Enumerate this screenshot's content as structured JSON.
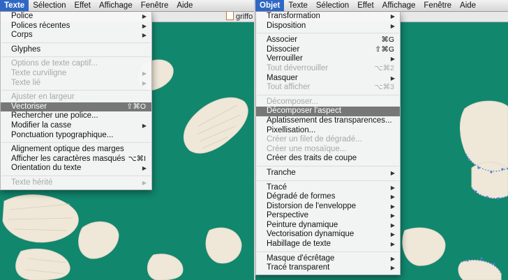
{
  "colors": {
    "canvas": "#11876e",
    "scribble": "#efe7d7",
    "highlight": "#777777",
    "menubar_active": "#2f68c4"
  },
  "left": {
    "menubar": [
      "Texte",
      "Sélection",
      "Effet",
      "Affichage",
      "Fenêtre",
      "Aide"
    ],
    "active_menu": "Texte",
    "doc_tab": "griffo",
    "menu": [
      {
        "label": "Police",
        "arrow": true
      },
      {
        "label": "Polices récentes",
        "arrow": true
      },
      {
        "label": "Corps",
        "arrow": true
      },
      {
        "sep": true
      },
      {
        "label": "Glyphes"
      },
      {
        "sep": true
      },
      {
        "label": "Options de texte captif...",
        "disabled": true
      },
      {
        "label": "Texte curviligne",
        "arrow": true,
        "disabled": true
      },
      {
        "label": "Texte lié",
        "arrow": true,
        "disabled": true
      },
      {
        "sep": true
      },
      {
        "label": "Ajuster en largeur",
        "disabled": true
      },
      {
        "label": "Vectoriser",
        "shortcut": "⇧⌘O",
        "highlight": true
      },
      {
        "label": "Rechercher une police..."
      },
      {
        "label": "Modifier la casse",
        "arrow": true
      },
      {
        "label": "Ponctuation typographique..."
      },
      {
        "sep": true
      },
      {
        "label": "Alignement optique des marges"
      },
      {
        "label": "Afficher les caractères masqués",
        "shortcut": "⌥⌘I"
      },
      {
        "label": "Orientation du texte",
        "arrow": true
      },
      {
        "sep": true
      },
      {
        "label": "Texte hérité",
        "arrow": true,
        "disabled": true
      }
    ]
  },
  "right": {
    "menubar": [
      "Objet",
      "Texte",
      "Sélection",
      "Effet",
      "Affichage",
      "Fenêtre",
      "Aide"
    ],
    "active_menu": "Objet",
    "menu": [
      {
        "label": "Transformation",
        "arrow": true
      },
      {
        "label": "Disposition",
        "arrow": true
      },
      {
        "sep": true
      },
      {
        "label": "Associer",
        "shortcut": "⌘G"
      },
      {
        "label": "Dissocier",
        "shortcut": "⇧⌘G"
      },
      {
        "label": "Verrouiller",
        "arrow": true
      },
      {
        "label": "Tout déverrouiller",
        "shortcut": "⌥⌘2",
        "disabled": true
      },
      {
        "label": "Masquer",
        "arrow": true
      },
      {
        "label": "Tout afficher",
        "shortcut": "⌥⌘3",
        "disabled": true
      },
      {
        "sep": true
      },
      {
        "label": "Décomposer...",
        "disabled": true
      },
      {
        "label": "Décomposer l'aspect",
        "highlight": true
      },
      {
        "label": "Aplatissement des transparences..."
      },
      {
        "label": "Pixellisation..."
      },
      {
        "label": "Créer un filet de dégradé...",
        "disabled": true
      },
      {
        "label": "Créer une mosaïque...",
        "disabled": true
      },
      {
        "label": "Créer des traits de coupe"
      },
      {
        "sep": true
      },
      {
        "label": "Tranche",
        "arrow": true
      },
      {
        "sep": true
      },
      {
        "label": "Tracé",
        "arrow": true
      },
      {
        "label": "Dégradé de formes",
        "arrow": true
      },
      {
        "label": "Distorsion de l'enveloppe",
        "arrow": true
      },
      {
        "label": "Perspective",
        "arrow": true
      },
      {
        "label": "Peinture dynamique",
        "arrow": true
      },
      {
        "label": "Vectorisation dynamique",
        "arrow": true
      },
      {
        "label": "Habillage de texte",
        "arrow": true
      },
      {
        "sep": true
      },
      {
        "label": "Masque d'écrêtage",
        "arrow": true
      },
      {
        "label": "Tracé transparent",
        "arrow": true
      }
    ]
  }
}
